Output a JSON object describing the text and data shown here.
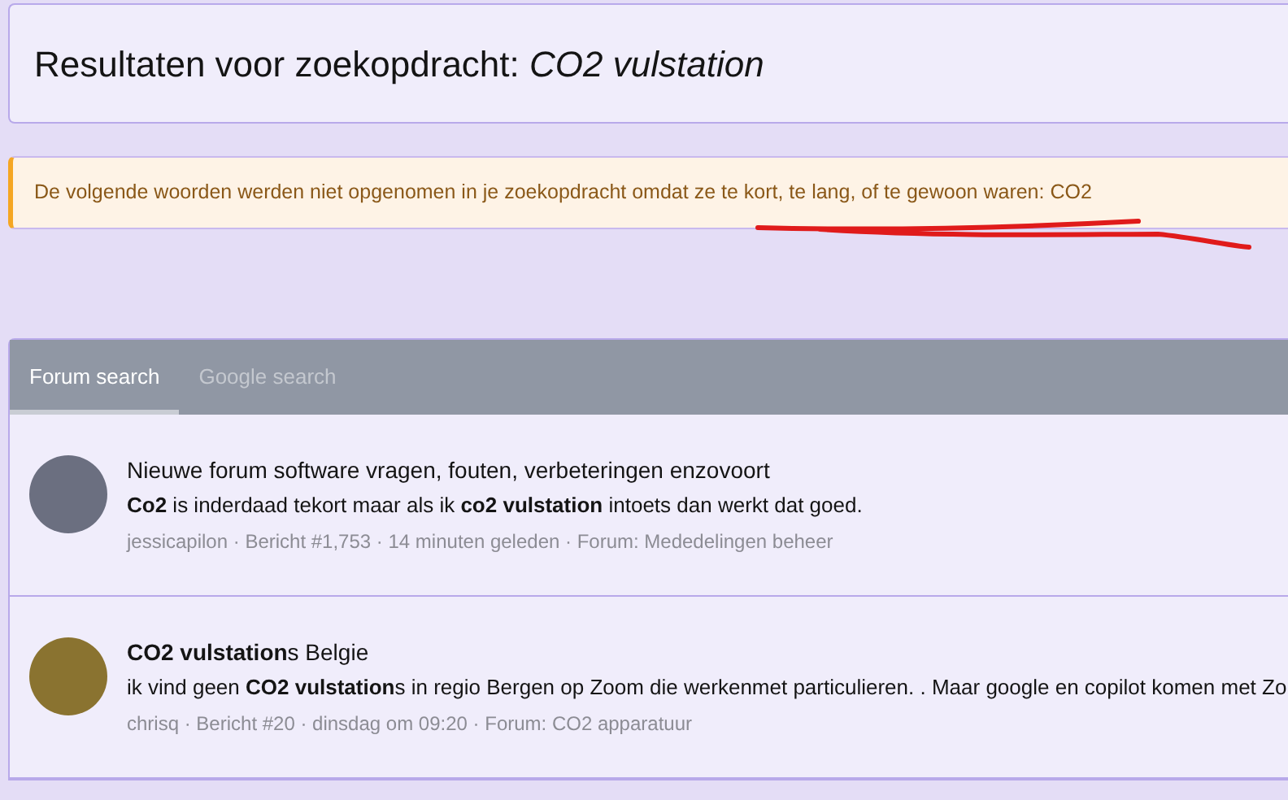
{
  "header": {
    "title_prefix": "Resultaten voor zoekopdracht:",
    "query": "CO2 vulstation"
  },
  "notice": {
    "text": "De volgende woorden werden niet opgenomen in je zoekopdracht omdat ze te kort, te lang, of te gewoon waren: CO2"
  },
  "tabs": [
    {
      "label": "Forum search",
      "selected": true
    },
    {
      "label": "Google search",
      "selected": false
    }
  ],
  "results": [
    {
      "title": "Nieuwe forum software vragen, fouten, verbeteringen enzovoort",
      "snippet": "**Co2** is inderdaad tekort maar als ik **co2 vulstation** intoets dan werkt dat goed.",
      "meta": "jessicapilon · Bericht #1,753 · 14 minuten geleden · Forum: Mededelingen beheer"
    },
    {
      "title": "**CO2 vulstation**s Belgie",
      "snippet": "ik vind geen **CO2 vulstation**s in regio Bergen op Zoom die werkenmet particulieren. . Maar google en copilot komen met Zo",
      "meta": "chrisq · Bericht #20 · dinsdag om 09:20 · Forum: CO2 apparatuur"
    }
  ]
}
